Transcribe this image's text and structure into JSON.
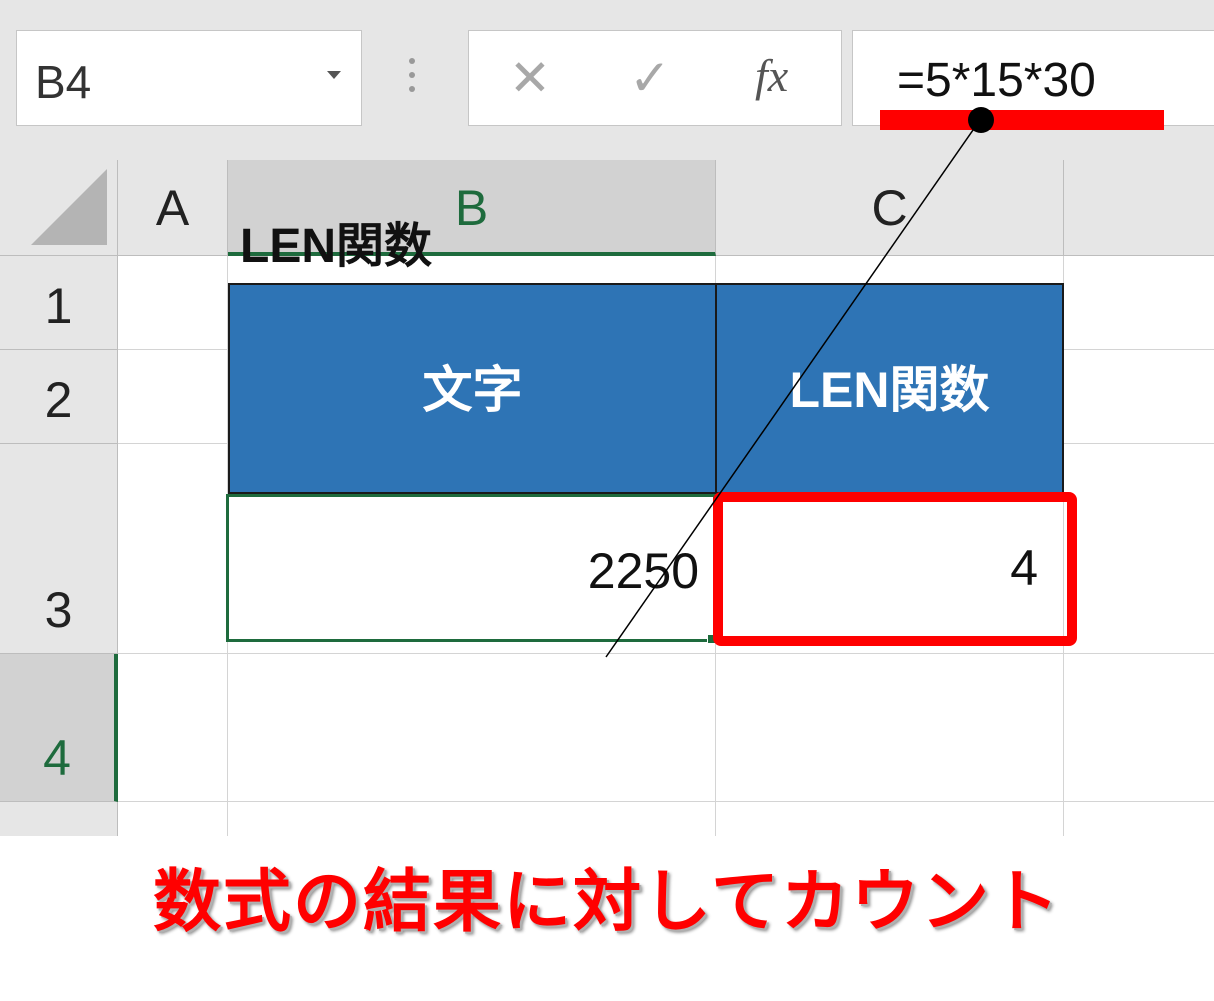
{
  "formula_bar": {
    "name_box": "B4",
    "cancel_symbol": "✕",
    "enter_symbol": "✓",
    "fx_symbol": "fx",
    "formula": "=5*15*30"
  },
  "columns": [
    "A",
    "B",
    "C"
  ],
  "rows": [
    "1",
    "2",
    "3",
    "4"
  ],
  "sheet": {
    "b2": "LEN関数",
    "b3": "文字",
    "c3": "LEN関数",
    "b4": "2250",
    "c4": "4"
  },
  "caption": "数式の結果に対してカウント",
  "colors": {
    "header_fill": "#2e74b5",
    "highlight": "#ff0000",
    "selection": "#1e6b3d"
  },
  "icons": [
    "dropdown-arrow-icon",
    "cancel-icon",
    "enter-check-icon",
    "function-fx-icon",
    "select-all-corner-icon"
  ]
}
